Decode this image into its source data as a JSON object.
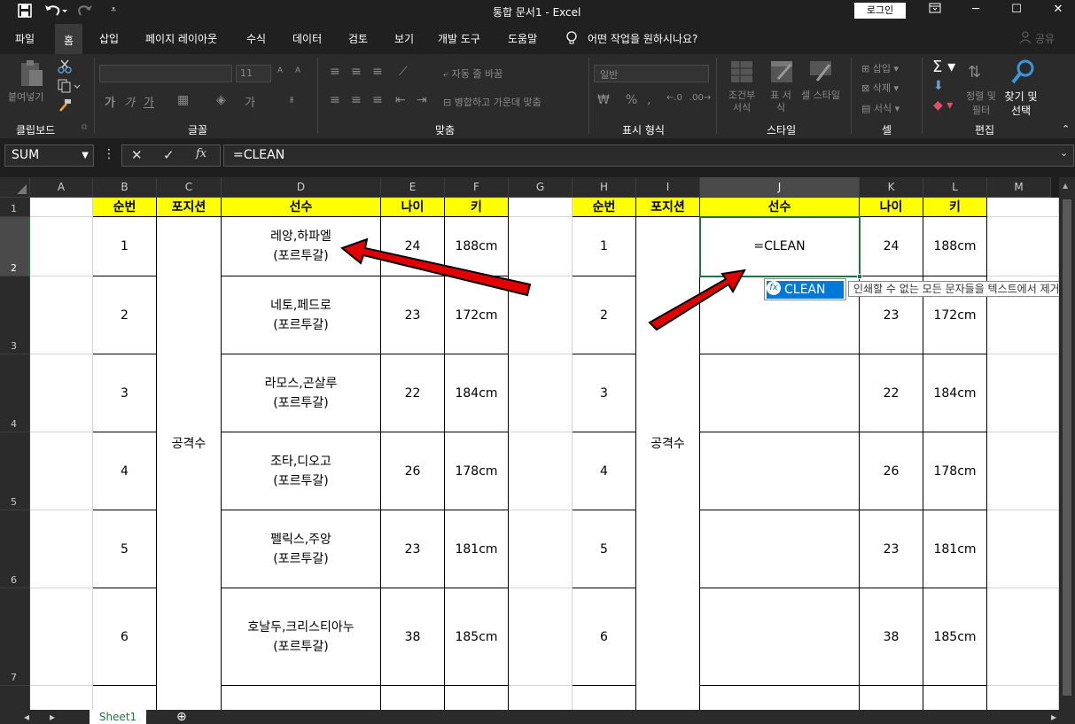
{
  "window": {
    "title": "통합 문서1  -  Excel",
    "login_label": "로그인",
    "minimize": "─",
    "maximize": "☐",
    "close": "✕"
  },
  "tabs": [
    "파일",
    "홈",
    "삽입",
    "페이지 레이아웃",
    "수식",
    "데이터",
    "검토",
    "보기",
    "개발 도구",
    "도움말"
  ],
  "active_tab": "홈",
  "tell_me": "어떤 작업을 원하시나요?",
  "share_label": "공유",
  "ribbon": {
    "paste": "붙여넣기",
    "clipboard": "클립보드",
    "font": "글꼴",
    "font_size": "11",
    "alignment": "맞춤",
    "wrap_text": "자동 줄 바꿈",
    "merge_center": "병합하고 가운데 맞춤",
    "number": "표시 형식",
    "number_format": "일반",
    "styles": "스타일",
    "cond_format": "조건부 서식",
    "table_format": "표 서식",
    "cell_styles": "셀 스타일",
    "cells": "셀",
    "insert": "삽입",
    "delete": "삭제",
    "format": "서식",
    "editing": "편집",
    "sort_filter": "정렬 및 필터",
    "find_select": "찾기 및 선택"
  },
  "formula": {
    "name_box": "SUM",
    "value": "=CLEAN",
    "fx": "fx"
  },
  "columns": [
    "A",
    "B",
    "C",
    "D",
    "E",
    "F",
    "G",
    "H",
    "I",
    "J",
    "K",
    "L",
    "M"
  ],
  "selected_column": "J",
  "rows": [
    "1",
    "2",
    "3",
    "4",
    "5",
    "6",
    "7"
  ],
  "selected_row": "2",
  "table": {
    "headers": [
      "순번",
      "포지션",
      "선수",
      "나이",
      "키"
    ],
    "position": "공격수",
    "records": [
      {
        "no": "1",
        "player": "레앙,하파엘\n(포르투갈)",
        "age": "24",
        "height": "188cm"
      },
      {
        "no": "2",
        "player": "네토,페드로\n(포르투갈)",
        "age": "23",
        "height": "172cm"
      },
      {
        "no": "3",
        "player": "라모스,곤살루\n(포르투갈)",
        "age": "22",
        "height": "184cm"
      },
      {
        "no": "4",
        "player": "조타,디오고\n(포르투갈)",
        "age": "26",
        "height": "178cm"
      },
      {
        "no": "5",
        "player": "펠릭스,주앙\n(포르투갈)",
        "age": "23",
        "height": "181cm"
      },
      {
        "no": "6",
        "player": "호날두,크리스티아누\n(포르투갈)",
        "age": "38",
        "height": "185cm"
      }
    ]
  },
  "editing_cell_value": "=CLEAN",
  "autocomplete": {
    "item": "CLEAN",
    "tooltip": "인쇄할 수 없는 모든 문자들을 텍스트에서 제거합니다."
  },
  "sheet": {
    "tab": "Sheet1",
    "add": "⊕"
  },
  "colors": {
    "header_fill": "#ffff00",
    "selection": "#217346",
    "autocomplete": "#0078d7",
    "arrow": "#e00000"
  }
}
